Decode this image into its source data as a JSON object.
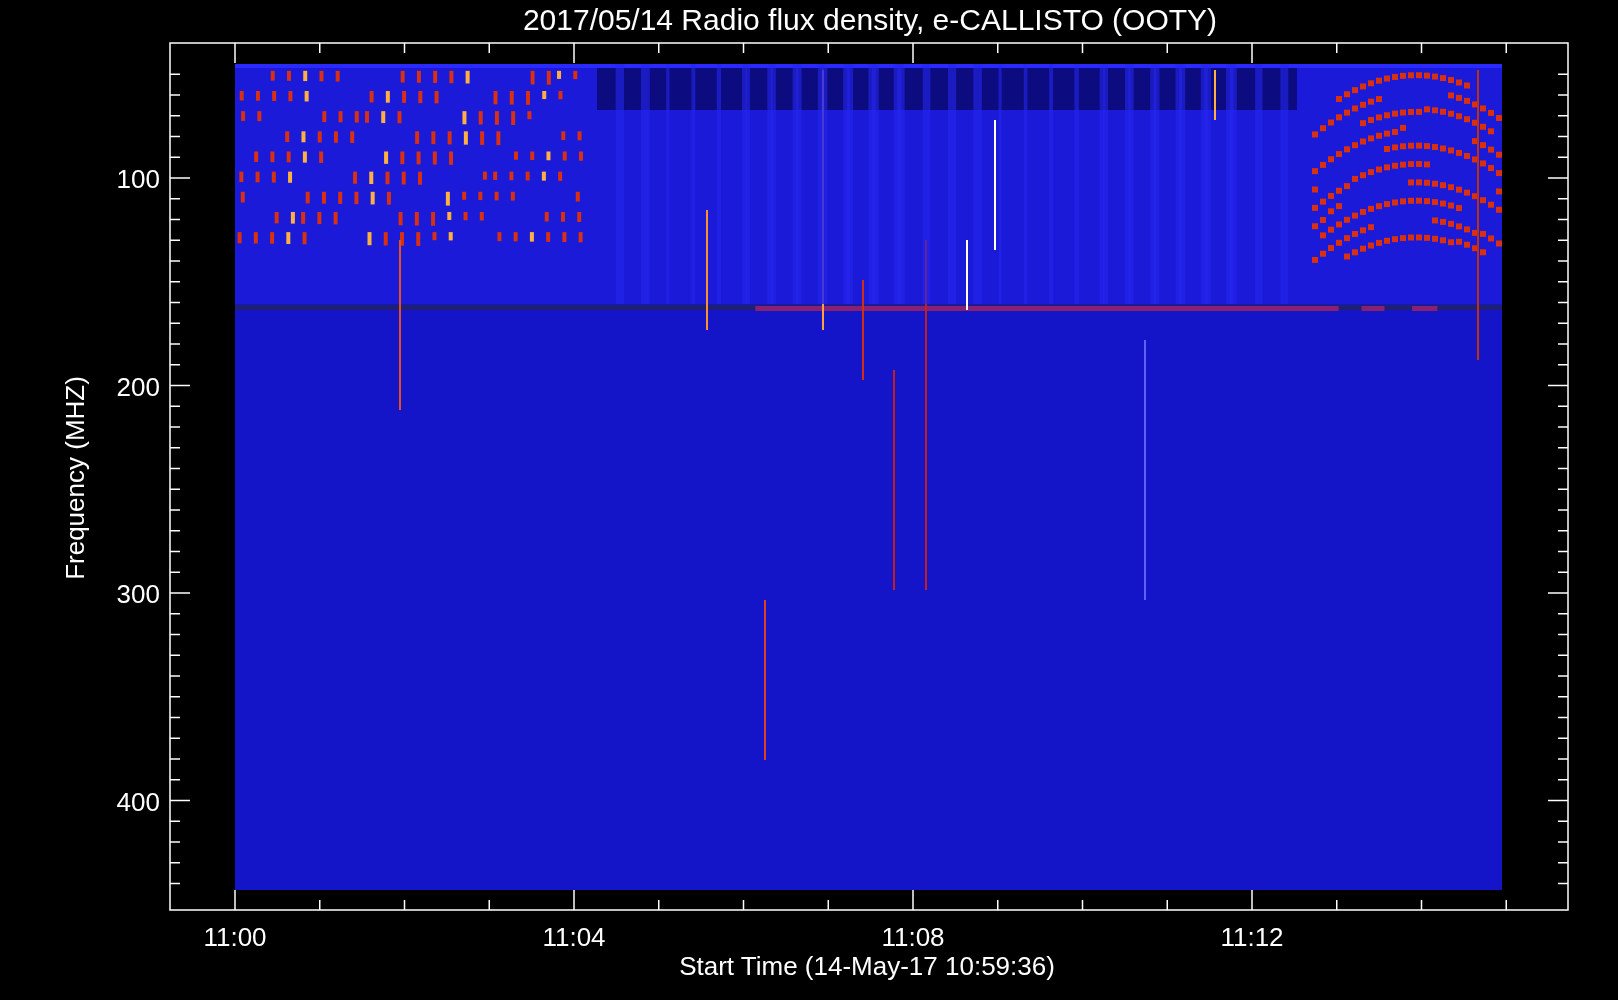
{
  "plot": {
    "title": "2017/05/14  Radio flux density, e-CALLISTO (OOTY)",
    "xlabel": "Start Time (14-May-17 10:59:36)",
    "ylabel": "Frequency (MHZ)",
    "xtick_labels": [
      "11:00",
      "11:04",
      "11:08",
      "11:12"
    ],
    "ytick_labels": [
      "100",
      "200",
      "300",
      "400"
    ]
  }
}
